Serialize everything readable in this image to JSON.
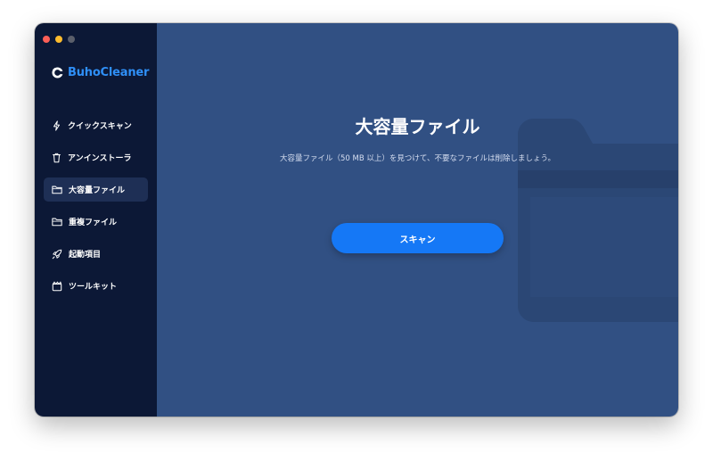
{
  "app": {
    "name": "BuhoCleaner"
  },
  "window_controls": {
    "close_color": "#fe5f57",
    "minimize_color": "#febc2e",
    "zoom_color": "#5b5f6b"
  },
  "sidebar": {
    "items": [
      {
        "label": "クイックスキャン",
        "icon": "lightning-icon",
        "active": false
      },
      {
        "label": "アンインストーラ",
        "icon": "trash-icon",
        "active": false
      },
      {
        "label": "大容量ファイル",
        "icon": "folder-icon",
        "active": true
      },
      {
        "label": "重複ファイル",
        "icon": "duplicate-folder-icon",
        "active": false
      },
      {
        "label": "起動項目",
        "icon": "rocket-icon",
        "active": false
      },
      {
        "label": "ツールキット",
        "icon": "toolkit-icon",
        "active": false
      }
    ]
  },
  "main": {
    "title": "大容量ファイル",
    "description": "大容量ファイル（50 MB 以上）を見つけて、不要なファイルは削除しましょう。",
    "scan_button_label": "スキャン"
  },
  "colors": {
    "sidebar_bg": "#0c1836",
    "main_bg": "#315083",
    "accent": "#1578f6",
    "brand": "#2f8ff7"
  }
}
